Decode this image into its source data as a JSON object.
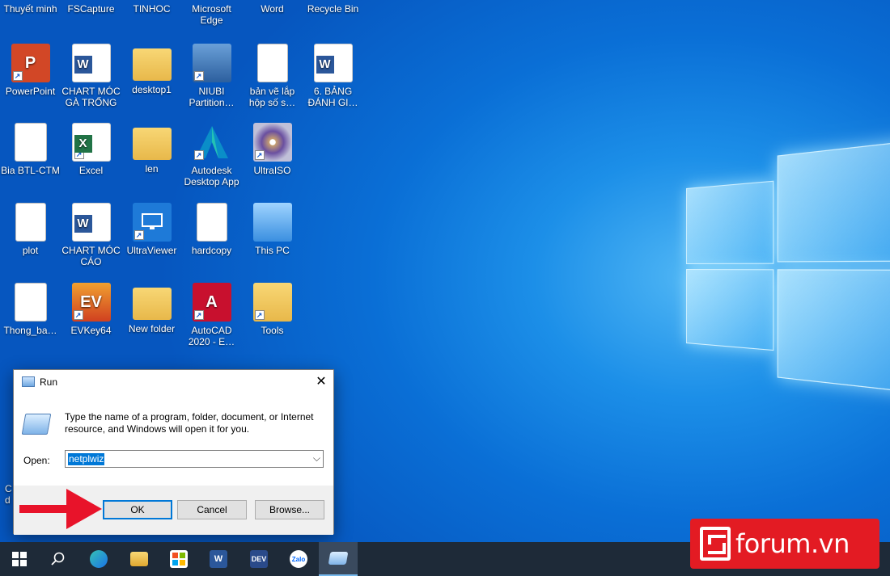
{
  "top_row": [
    "Thuyết minh",
    "FSCapture",
    "TINHOC",
    "Microsoft Edge",
    "Word",
    "Recycle Bin"
  ],
  "icons": [
    {
      "label": "PowerPoint",
      "icon": "powerpoint-icon"
    },
    {
      "label": "CHART MÓC GÀ TRỐNG",
      "icon": "word-doc-icon"
    },
    {
      "label": "desktop1",
      "icon": "folder-icon"
    },
    {
      "label": "NIUBI Partition…",
      "icon": "niubi-icon"
    },
    {
      "label": "bản vẽ lắp hộp số s…",
      "icon": "blank-file-icon"
    },
    {
      "label": "6. BẢNG ĐÁNH GI…",
      "icon": "word-doc-icon"
    },
    {
      "label": "Bia BTL-CTM",
      "icon": "document-thumb-icon"
    },
    {
      "label": "Excel",
      "icon": "excel-icon"
    },
    {
      "label": "len",
      "icon": "folder-icon"
    },
    {
      "label": "Autodesk Desktop App",
      "icon": "autodesk-icon"
    },
    {
      "label": "UltraISO",
      "icon": "ultraiso-icon"
    },
    {
      "label": "plot",
      "icon": "blank-file-icon"
    },
    {
      "label": "CHART MÓC CÁO",
      "icon": "word-doc-icon"
    },
    {
      "label": "UltraViewer",
      "icon": "ultraviewer-icon"
    },
    {
      "label": "hardcopy",
      "icon": "blank-file-icon"
    },
    {
      "label": "This PC",
      "icon": "this-pc-icon"
    },
    {
      "label": "Thong_ba…",
      "icon": "document-thumb-icon"
    },
    {
      "label": "EVKey64",
      "icon": "evkey-icon"
    },
    {
      "label": "New folder",
      "icon": "folder-icon"
    },
    {
      "label": "AutoCAD 2020 - E…",
      "icon": "autocad-icon"
    },
    {
      "label": "Tools",
      "icon": "tools-folder-icon"
    }
  ],
  "partial_behind_dialog": [
    "C",
    "d"
  ],
  "run_dialog": {
    "title": "Run",
    "close_glyph": "✕",
    "description": "Type the name of a program, folder, document, or Internet resource, and Windows will open it for you.",
    "open_label": "Open:",
    "open_value": "netplwiz",
    "dropdown_glyph": "⌵",
    "ok_label": "OK",
    "cancel_label": "Cancel",
    "browse_label": "Browse..."
  },
  "taskbar": {
    "items": [
      "start-button",
      "search-icon",
      "edge-icon",
      "file-explorer-icon",
      "store-icon",
      "word-icon",
      "devcpp-icon",
      "zalo-icon",
      "run-icon"
    ],
    "zalo_label": "Zalo",
    "dev_label": "DEV",
    "word_label": "W"
  },
  "watermark": {
    "text": "forum.vn"
  },
  "colors": {
    "accent": "#0078d7",
    "arrow": "#e8132a",
    "watermark": "#e31b23",
    "taskbar": "#1e2a38"
  }
}
